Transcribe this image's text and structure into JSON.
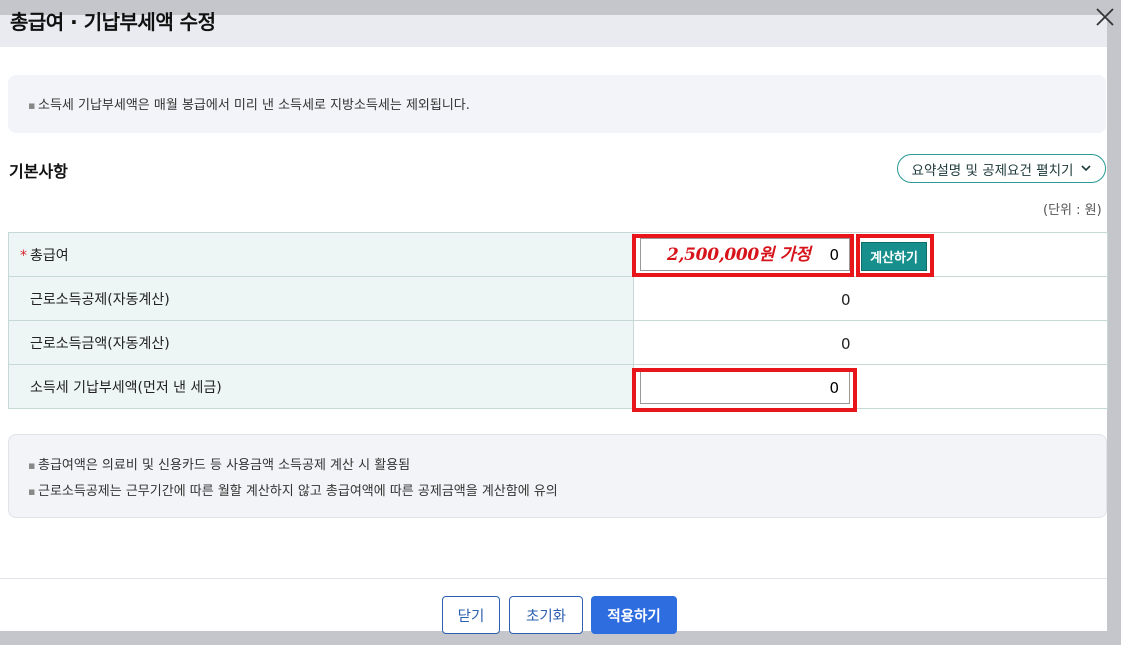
{
  "modal": {
    "title": "총급여 · 기납부세액 수정"
  },
  "notice": {
    "text": "소득세 기납부세액은 매월 봉급에서 미리 낸 소득세로 지방소득세는 제외됩니다."
  },
  "section": {
    "title": "기본사항",
    "expand_label": "요약설명 및 공제요건 펼치기",
    "unit": "(단위 : 원)"
  },
  "rows": [
    {
      "required_mark": "*",
      "label": "총급여",
      "value": "0",
      "annotation": "2,500,000원 가정",
      "button": "계산하기"
    },
    {
      "label": "근로소득공제(자동계산)",
      "value": "0"
    },
    {
      "label": "근로소득금액(자동계산)",
      "value": "0"
    },
    {
      "label": "소득세 기납부세액(먼저 낸 세금)",
      "value": "0"
    }
  ],
  "help": [
    "총급여액은 의료비 및 신용카드 등 사용금액 소득공제 계산 시 활용됨",
    "근로소득공제는 근무기간에 따른 월할 계산하지 않고 총급여액에 따른 공제금액을 계산함에 유의"
  ],
  "footer": {
    "close": "닫기",
    "reset": "초기화",
    "apply": "적용하기"
  },
  "colors": {
    "accent_teal": "#178f8d",
    "primary_blue": "#2e6de0",
    "highlight_red": "#e8161b"
  }
}
